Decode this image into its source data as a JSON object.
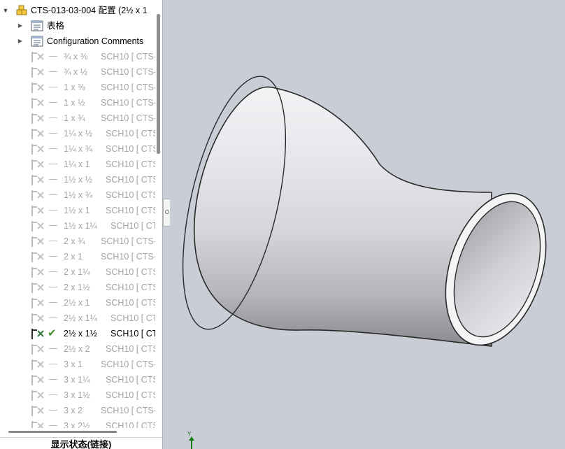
{
  "feature_tree": {
    "root_label": "CTS-013-03-004 配置 (2½ x 1",
    "folders": [
      {
        "label": "表格",
        "icon": "table-icon"
      },
      {
        "label": "Configuration Comments",
        "icon": "comments-folder-icon"
      }
    ],
    "configurations": [
      {
        "size": "¾ x ⅜",
        "spec": "SCH10 [ CTS-",
        "active": false
      },
      {
        "size": "¾ x ½",
        "spec": "SCH10 [ CTS-",
        "active": false
      },
      {
        "size": "1 x ⅜",
        "spec": "SCH10 [ CTS-1",
        "active": false
      },
      {
        "size": "1 x ½",
        "spec": "SCH10 [ CTS-1",
        "active": false
      },
      {
        "size": "1 x ¾",
        "spec": "SCH10 [ CTS-1",
        "active": false
      },
      {
        "size": "1¼ x ½",
        "spec": "SCH10 [ CTS",
        "active": false
      },
      {
        "size": "1¼ x ¾",
        "spec": "SCH10 [ CTS",
        "active": false
      },
      {
        "size": "1¼ x 1",
        "spec": "SCH10 [ CTS-",
        "active": false
      },
      {
        "size": "1½ x ½",
        "spec": "SCH10 [ CTS",
        "active": false
      },
      {
        "size": "1½ x ¾",
        "spec": "SCH10 [ CTS",
        "active": false
      },
      {
        "size": "1½ x 1",
        "spec": "SCH10 [ CTS-",
        "active": false
      },
      {
        "size": "1½ x 1¼",
        "spec": "SCH10 [ CT",
        "active": false
      },
      {
        "size": "2 x ¾",
        "spec": "SCH10 [ CTS-1",
        "active": false
      },
      {
        "size": "2 x 1",
        "spec": "SCH10 [ CTS-1",
        "active": false
      },
      {
        "size": "2 x 1¼",
        "spec": "SCH10 [ CTS-",
        "active": false
      },
      {
        "size": "2 x 1½",
        "spec": "SCH10 [ CTS-",
        "active": false
      },
      {
        "size": "2½ x 1",
        "spec": "SCH10 [ CTS-",
        "active": false
      },
      {
        "size": "2½ x 1¼",
        "spec": "SCH10 [ CT",
        "active": false
      },
      {
        "size": "2½ x 1½",
        "spec": "SCH10 [ CT",
        "active": true
      },
      {
        "size": "2½ x 2",
        "spec": "SCH10 [ CTS-",
        "active": false
      },
      {
        "size": "3 x 1",
        "spec": "SCH10 [ CTS-1",
        "active": false
      },
      {
        "size": "3 x 1¼",
        "spec": "SCH10 [ CTS-",
        "active": false
      },
      {
        "size": "3 x 1½",
        "spec": "SCH10 [ CTS-",
        "active": false
      },
      {
        "size": "3 x 2",
        "spec": "SCH10 [ CTS-1",
        "active": false
      },
      {
        "size": "3 x 2½",
        "spec": "SCH10 [ CTS",
        "active": false
      }
    ]
  },
  "bottom_panel": {
    "label": "显示状态(链接)"
  },
  "viewport": {
    "triad_axis_label": "Y"
  },
  "colors": {
    "viewport_bg": "#c9cdd6",
    "inactive_text": "#a3a3a3",
    "active_check": "#3d8a1f",
    "axis_green": "#1a7a1a"
  }
}
